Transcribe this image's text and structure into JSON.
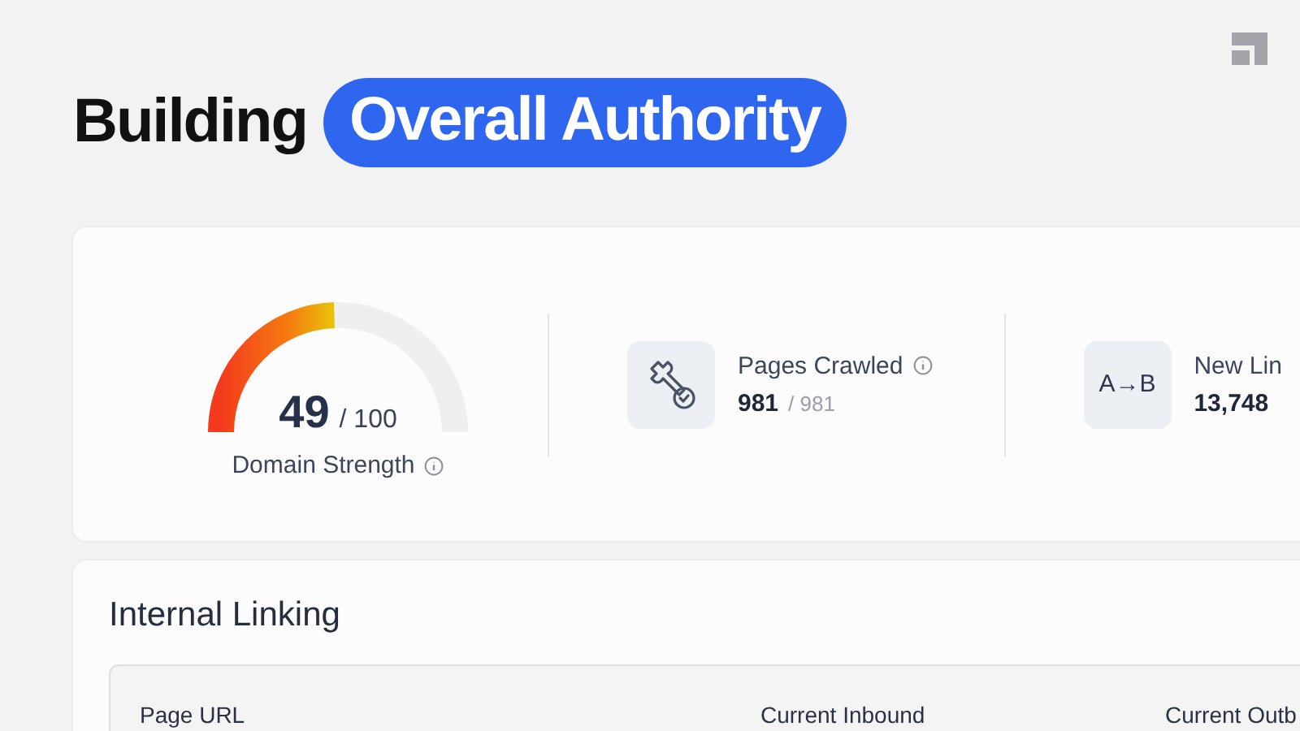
{
  "headline": {
    "text": "Building",
    "highlight": "Overall Authority"
  },
  "gauge": {
    "value": "49",
    "max": "/ 100",
    "label": "Domain Strength",
    "info": true,
    "level": 0.49
  },
  "stats": [
    {
      "kind": "wrench",
      "label": "Pages Crawled",
      "info": true,
      "value": "981",
      "total": "/ 981"
    },
    {
      "kind": "text",
      "icon_text": "A→B",
      "label": "New Lin",
      "value": "13,748"
    }
  ],
  "section": {
    "title": "Internal Linking",
    "columns": [
      "Page URL",
      "Current Inbound",
      "Current Outb"
    ]
  }
}
